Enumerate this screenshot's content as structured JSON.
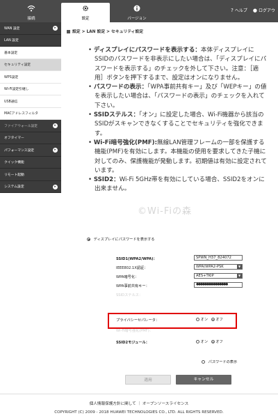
{
  "nav": {
    "tabs": [
      {
        "label": "接続",
        "icon": "wifi-icon"
      },
      {
        "label": "設定",
        "icon": "gear-icon"
      },
      {
        "label": "バージョン",
        "icon": "info-icon"
      }
    ],
    "help": "ヘルプ",
    "logout": "ログアウ"
  },
  "sidebar": {
    "items": [
      {
        "label": "WAN 設定"
      },
      {
        "label": "LAN 設定"
      },
      {
        "label": "基本設定"
      },
      {
        "label": "セキュリティ設定"
      },
      {
        "label": "WPS設定"
      },
      {
        "label": "Wi-Fi設定引継し"
      },
      {
        "label": "USB通信"
      },
      {
        "label": "MACアドレスフィルタ"
      },
      {
        "label": "ファイアウォール設定"
      },
      {
        "label": "オフタイマー"
      },
      {
        "label": "パフォーマンス設定"
      },
      {
        "label": "クイック機能"
      },
      {
        "label": "リモート起動"
      },
      {
        "label": "システム設定"
      }
    ]
  },
  "breadcrumb": "設定 > LAN 設定 > セキュリティ設定",
  "explain": [
    {
      "head": "ディスプレイにパスワードを表示する：",
      "body": "本体ディスプレイにSSIDのパスワードを非表示にしたい場合は、「ディスプレイにパスワードを表示する」のチェックを外して下さい。注意：［適用］ボタンを押下するまで、設定はオンになりません。"
    },
    {
      "head": "パスワードの表示：",
      "body": "「WPA事前共有キー」及び「WEPキー」の値を表示したい場合は、「パスワードの表示」のチェックを入れて下さい。"
    },
    {
      "head": "SSIDステルス：",
      "body": "「オン」に設定した場合、Wi-Fi機器から該当のSSIDがスキャンできなくすることでセキュリティを強化できます。"
    },
    {
      "head": "Wi-Fi暗号強化(PMF):",
      "body": "無線LAN管理フレームの一部を保護する機能(PMF)を有効にします。本機能の使用を要求してきた子機に対してのみ、保護機能が発動します。初期値は有効に設定されています。"
    },
    {
      "head": "SSID2：",
      "body": "Wi-Fi 5GHz帯を有効にしている場合、SSID2をオンに出来ません。"
    }
  ],
  "watermark": "©Wi-Fiの森",
  "form": {
    "display_password_label": "ディスプレイにパスワードを表示する",
    "ssid1_label": "SSID1(WPA2/WPA)：",
    "ssid1_value": "SPWN_H37_824072",
    "ieee_label": "IEEE802.1X認証：",
    "ieee_value": "WPA/WPA2-PSK",
    "wpa_enc_label": "WPA暗号化：",
    "wpa_enc_value": "AES+TKIP",
    "wpa_key_label": "WPA事前共有キー：",
    "wpa_key_value": "●●●●●●●●●●●●●●●",
    "ssid_stealth_label": "SSIDステルス：",
    "privacy_label": "プライバシーセパレータ：",
    "wifi_pmf_label": "Wi-Fi暗号強化(PMF)：",
    "on": "オン",
    "off": "オフ",
    "ssid2_label": "SSID2モジュール：",
    "show_password_label": "パスワードの表示",
    "apply": "適用",
    "cancel": "キャンセル"
  },
  "footer": {
    "links": "個人情報保護方針に関して ｜ オープンソースライセンス",
    "copyright": "COPYRIGHT (C) 2009 - 2018 HUAWEI TECHNOLOGIES CO., LTD. ALL RIGHTS RESERVED."
  },
  "colors": {
    "highlight": "#e00000",
    "nav_bg": "#4a4a4a"
  }
}
